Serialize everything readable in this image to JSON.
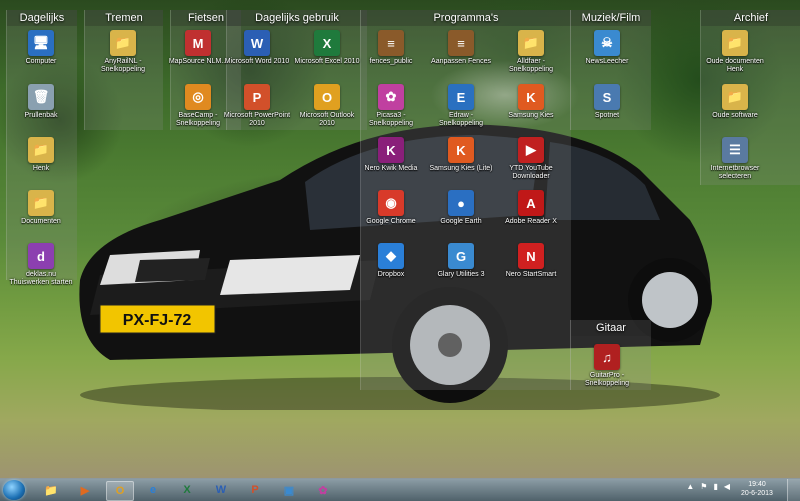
{
  "fences": [
    {
      "title": "Dagelijks"
    },
    {
      "title": "Tremen"
    },
    {
      "title": "Fietsen"
    },
    {
      "title": "Dagelijks gebruik"
    },
    {
      "title": "Programma's"
    },
    {
      "title": "Muziek/Film"
    },
    {
      "title": "Archief"
    },
    {
      "title": "Gitaar"
    }
  ],
  "icons": [
    {
      "label": "Computer",
      "glyph": "🖥",
      "color": "#2a6fc2"
    },
    {
      "label": "Prullenbak",
      "glyph": "🗑",
      "color": "#8aa0b0"
    },
    {
      "label": "Henk",
      "glyph": "📁",
      "color": "#d9b44a"
    },
    {
      "label": "Documenten",
      "glyph": "📁",
      "color": "#d9b44a"
    },
    {
      "label": "deklas.nu Thuiswerken starten",
      "glyph": "d",
      "color": "#8c3fb0"
    },
    {
      "label": "AnyRailNL - Snelkoppeling",
      "glyph": "📁",
      "color": "#d9b44a"
    },
    {
      "label": "MapSource NLM...",
      "glyph": "M",
      "color": "#c03030"
    },
    {
      "label": "BaseCamp - Snelkoppeling",
      "glyph": "◎",
      "color": "#e08a20"
    },
    {
      "label": "Microsoft Word 2010",
      "glyph": "W",
      "color": "#2b5fb4"
    },
    {
      "label": "Microsoft PowerPoint 2010",
      "glyph": "P",
      "color": "#d2502a"
    },
    {
      "label": "Microsoft Excel 2010",
      "glyph": "X",
      "color": "#1f7a3c"
    },
    {
      "label": "Microsoft Outlook 2010",
      "glyph": "O",
      "color": "#e0a020"
    },
    {
      "label": "fences_public",
      "glyph": "≡",
      "color": "#8a5a2a"
    },
    {
      "label": "Picasa3 - Snelkoppeling",
      "glyph": "✿",
      "color": "#c040a0"
    },
    {
      "label": "Nero Kwik Media",
      "glyph": "K",
      "color": "#8a1f7a"
    },
    {
      "label": "Google Chrome",
      "glyph": "◉",
      "color": "#d83a2a"
    },
    {
      "label": "Dropbox",
      "glyph": "◆",
      "color": "#2a7fd8"
    },
    {
      "label": "Aanpassen Fences",
      "glyph": "≡",
      "color": "#8a5a2a"
    },
    {
      "label": "Edraw - Snelkoppeling",
      "glyph": "E",
      "color": "#2a70c0"
    },
    {
      "label": "Samsung Kies (Lite)",
      "glyph": "K",
      "color": "#e05a20"
    },
    {
      "label": "Google Earth",
      "glyph": "●",
      "color": "#2a6fc2"
    },
    {
      "label": "Glary Utilities 3",
      "glyph": "G",
      "color": "#3a8ad0"
    },
    {
      "label": "Alldfaer - Snelkoppeling",
      "glyph": "📁",
      "color": "#d9b44a"
    },
    {
      "label": "Samsung Kies",
      "glyph": "K",
      "color": "#e05a20"
    },
    {
      "label": "YTD YouTube Downloader",
      "glyph": "▶",
      "color": "#c02020"
    },
    {
      "label": "Adobe Reader X",
      "glyph": "A",
      "color": "#c01818"
    },
    {
      "label": "Nero StartSmart",
      "glyph": "N",
      "color": "#d02020"
    },
    {
      "label": "NewsLeecher",
      "glyph": "☠",
      "color": "#3a8ad0"
    },
    {
      "label": "Spotnet",
      "glyph": "S",
      "color": "#4a7ab0"
    },
    {
      "label": "Oude documenten Henk",
      "glyph": "📁",
      "color": "#d9b44a"
    },
    {
      "label": "Oude software",
      "glyph": "📁",
      "color": "#d9b44a"
    },
    {
      "label": "Internetbrowser selecteren",
      "glyph": "☰",
      "color": "#5a7aa0"
    },
    {
      "label": "GuitarPro - Snelkoppeling",
      "glyph": "♫",
      "color": "#b02020"
    }
  ],
  "car": {
    "plate": "PX-FJ-72"
  },
  "taskbar": {
    "pinned": [
      {
        "name": "explorer",
        "glyph": "📁",
        "color": "#d9b44a"
      },
      {
        "name": "media-player",
        "glyph": "▶",
        "color": "#e06a20"
      },
      {
        "name": "outlook",
        "glyph": "O",
        "color": "#e0a020"
      },
      {
        "name": "internet-explorer",
        "glyph": "e",
        "color": "#2a7fd8"
      },
      {
        "name": "excel",
        "glyph": "X",
        "color": "#1f7a3c"
      },
      {
        "name": "word",
        "glyph": "W",
        "color": "#2b5fb4"
      },
      {
        "name": "powerpoint",
        "glyph": "P",
        "color": "#d2502a"
      },
      {
        "name": "photo-viewer",
        "glyph": "▣",
        "color": "#3a8ad0"
      },
      {
        "name": "picasa",
        "glyph": "✿",
        "color": "#c040a0"
      }
    ],
    "time": "19:40",
    "date": "20-6-2013"
  }
}
